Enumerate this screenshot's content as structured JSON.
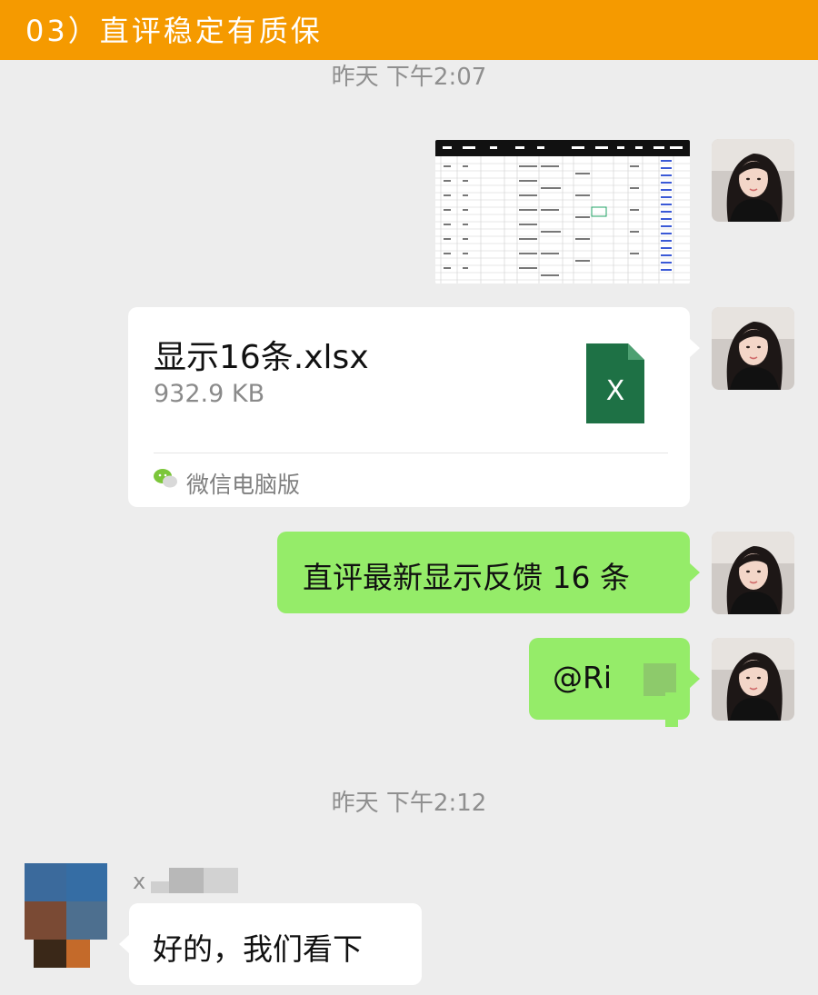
{
  "banner": {
    "title": "03）直评稳定有质保"
  },
  "timestamps": [
    "昨天 下午2:07",
    "昨天 下午2:12"
  ],
  "messages": {
    "file": {
      "name": "显示16条.xlsx",
      "size": "932.9 KB",
      "source": "微信电脑版",
      "icon": "excel-icon",
      "icon_letter": "X"
    },
    "text1": "直评最新显示反馈 16 条",
    "text2": "@Ri",
    "reply": "好的，我们看下"
  },
  "contact": {
    "name_visible": "x"
  },
  "colors": {
    "banner": "#f59a00",
    "self_bubble": "#95ec69",
    "other_bubble": "#ffffff",
    "background": "#ededed",
    "excel_green": "#1e7145"
  }
}
